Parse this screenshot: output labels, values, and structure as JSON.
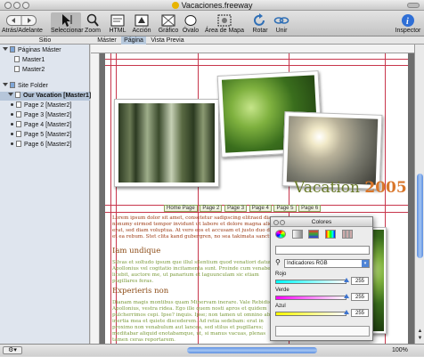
{
  "window": {
    "title": "Vacaciones.freeway"
  },
  "toolbar": {
    "items": [
      {
        "label": "Atrás/Adelante",
        "icon": "back-forward-icon"
      },
      {
        "label": "Seleccionar",
        "icon": "arrow-cursor-icon"
      },
      {
        "label": "Zoom",
        "icon": "magnifier-icon"
      },
      {
        "label": "HTML",
        "icon": "html-box-icon"
      },
      {
        "label": "Acción",
        "icon": "action-icon"
      },
      {
        "label": "Gráfico",
        "icon": "graphic-box-icon"
      },
      {
        "label": "Óvalo",
        "icon": "oval-icon"
      },
      {
        "label": "Área de Mapa",
        "icon": "map-area-icon"
      },
      {
        "label": "Rotar",
        "icon": "rotate-icon"
      },
      {
        "label": "Unir",
        "icon": "link-icon"
      },
      {
        "label": "Inspector",
        "icon": "info-icon"
      }
    ]
  },
  "tabs": {
    "sitio": "Sitio",
    "master": "Máster",
    "pagina": "Página",
    "vista_previa": "Vista Previa"
  },
  "sidebar": {
    "master_section": "Páginas Máster",
    "masters": [
      "Master1",
      "Master2"
    ],
    "site_section": "Site Folder",
    "root_page": "Our Vacation [Master1]",
    "pages": [
      "Page 2 [Master2]",
      "Page 3 [Master2]",
      "Page 4 [Master2]",
      "Page 5 [Master2]",
      "Page 6 [Master2]"
    ]
  },
  "page": {
    "title_word": "Vacation",
    "title_year": "2005",
    "nav": [
      "Home Page",
      "Page 2",
      "Page 3",
      "Page 4",
      "Page 5",
      "Page 6"
    ],
    "intro": "Lorem ipsum dolor sit amet, consetetur sadipscing elitraed diam nonumy eirmod tempor invidunt ut labore et dolore magna aliquyam erat, sed diam voluptua. At vero eos et accusam et justo duo dolores et ea rebum. Stet clita kand gubergren, no sea takimata sanctus est.",
    "heading1": "Iam undique",
    "para1": "Silvas et soltudo ipsum que illul silentium quod venatiori datur Apollonius vel cogitatio incitamenta sunt. Proinde cum venabere, licebit, auctore me, ut panarium et laguunculam sic etiam pugillares feras.",
    "heading2": "Experieris non",
    "para2": "Dianam magis montibus quam Minervam inerare. Vale Rebidis, Apollonius, vestra ridea. Ego ille quem nosti apros et quidem pulcherrimos cepi. Ipse? inquis. Ipse; non tamen ut omnino ab inertia mea et quiete discederem. Ad retia sedebam: erat in proximo non venabulum aut lancea, sed stilus et pugillares; meditabar aliquid enotabamque, ut, si manus vacuas, plenas tamen ceras reportarem."
  },
  "colors_panel": {
    "title": "Colores",
    "mode": "Indicadores RGB",
    "channels": [
      {
        "label": "Rojo",
        "value": "255"
      },
      {
        "label": "Verde",
        "value": "255"
      },
      {
        "label": "Azul",
        "value": "255"
      }
    ]
  },
  "status": {
    "zoom": "100%"
  }
}
